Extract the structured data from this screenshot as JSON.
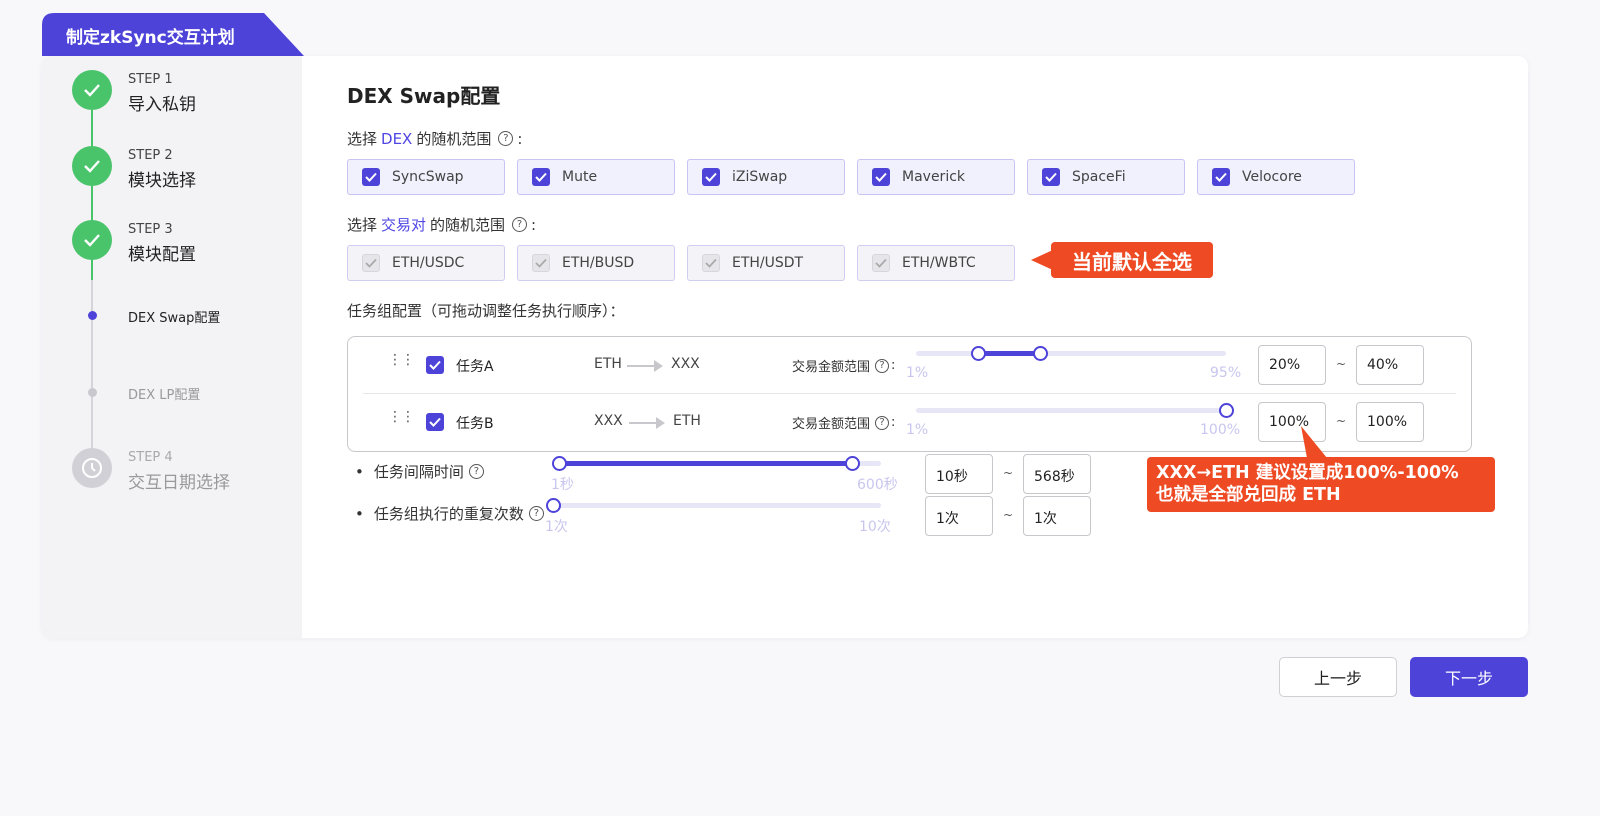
{
  "app_title": "制定zkSync交互计划",
  "steps": [
    {
      "tag": "STEP 1",
      "name": "导入私钥",
      "state": "done"
    },
    {
      "tag": "STEP 2",
      "name": "模块选择",
      "state": "done"
    },
    {
      "tag": "STEP 3",
      "name": "模块配置",
      "state": "done"
    },
    {
      "sub": "DEX Swap配置",
      "state": "active"
    },
    {
      "sub": "DEX LP配置",
      "state": "pending"
    },
    {
      "tag": "STEP 4",
      "name": "交互日期选择",
      "state": "pending"
    }
  ],
  "section_title": "DEX Swap配置",
  "dex_label": {
    "pre": "选择",
    "hl": "DEX",
    "post": "的随机范围"
  },
  "dex_options": [
    "SyncSwap",
    "Mute",
    "iZiSwap",
    "Maverick",
    "SpaceFi",
    "Velocore"
  ],
  "pair_label": {
    "pre": "选择",
    "hl": "交易对",
    "post": "的随机范围"
  },
  "pair_options": [
    "ETH/USDC",
    "ETH/BUSD",
    "ETH/USDT",
    "ETH/WBTC"
  ],
  "callout_default": "当前默认全选",
  "task_group_label": "任务组配置（可拖动调整任务执行顺序）：",
  "tasks": [
    {
      "name": "任务A",
      "from": "ETH",
      "to": "XXX",
      "amount_label": "交易金额范围",
      "min_tick": "1%",
      "max_tick": "95%",
      "low": "20%",
      "high": "40%",
      "low_pct": 20,
      "high_pct": 40
    },
    {
      "name": "任务B",
      "from": "XXX",
      "to": "ETH",
      "amount_label": "交易金额范围",
      "min_tick": "1%",
      "max_tick": "100%",
      "low": "100%",
      "high": "100%",
      "low_pct": 100,
      "high_pct": 100
    }
  ],
  "callout_eth": {
    "line1": "XXX→ETH 建议设置成100%-100%",
    "line2": "也就是全部兑回成 ETH"
  },
  "interval": {
    "label": "任务间隔时间",
    "min_tick": "1秒",
    "max_tick": "600秒",
    "low": "10秒",
    "high": "568秒",
    "low_val": 1,
    "high_val": 568
  },
  "repeat": {
    "label": "任务组执行的重复次数",
    "min_tick": "1次",
    "max_tick": "10次",
    "low": "1次",
    "high": "1次",
    "low_val": 1,
    "high_val": 1
  },
  "tilde": "~",
  "buttons": {
    "prev": "上一步",
    "next": "下一步"
  },
  "colors": {
    "accent": "#4d43d9",
    "done": "#4ac46b",
    "callout": "#ee4a23"
  }
}
